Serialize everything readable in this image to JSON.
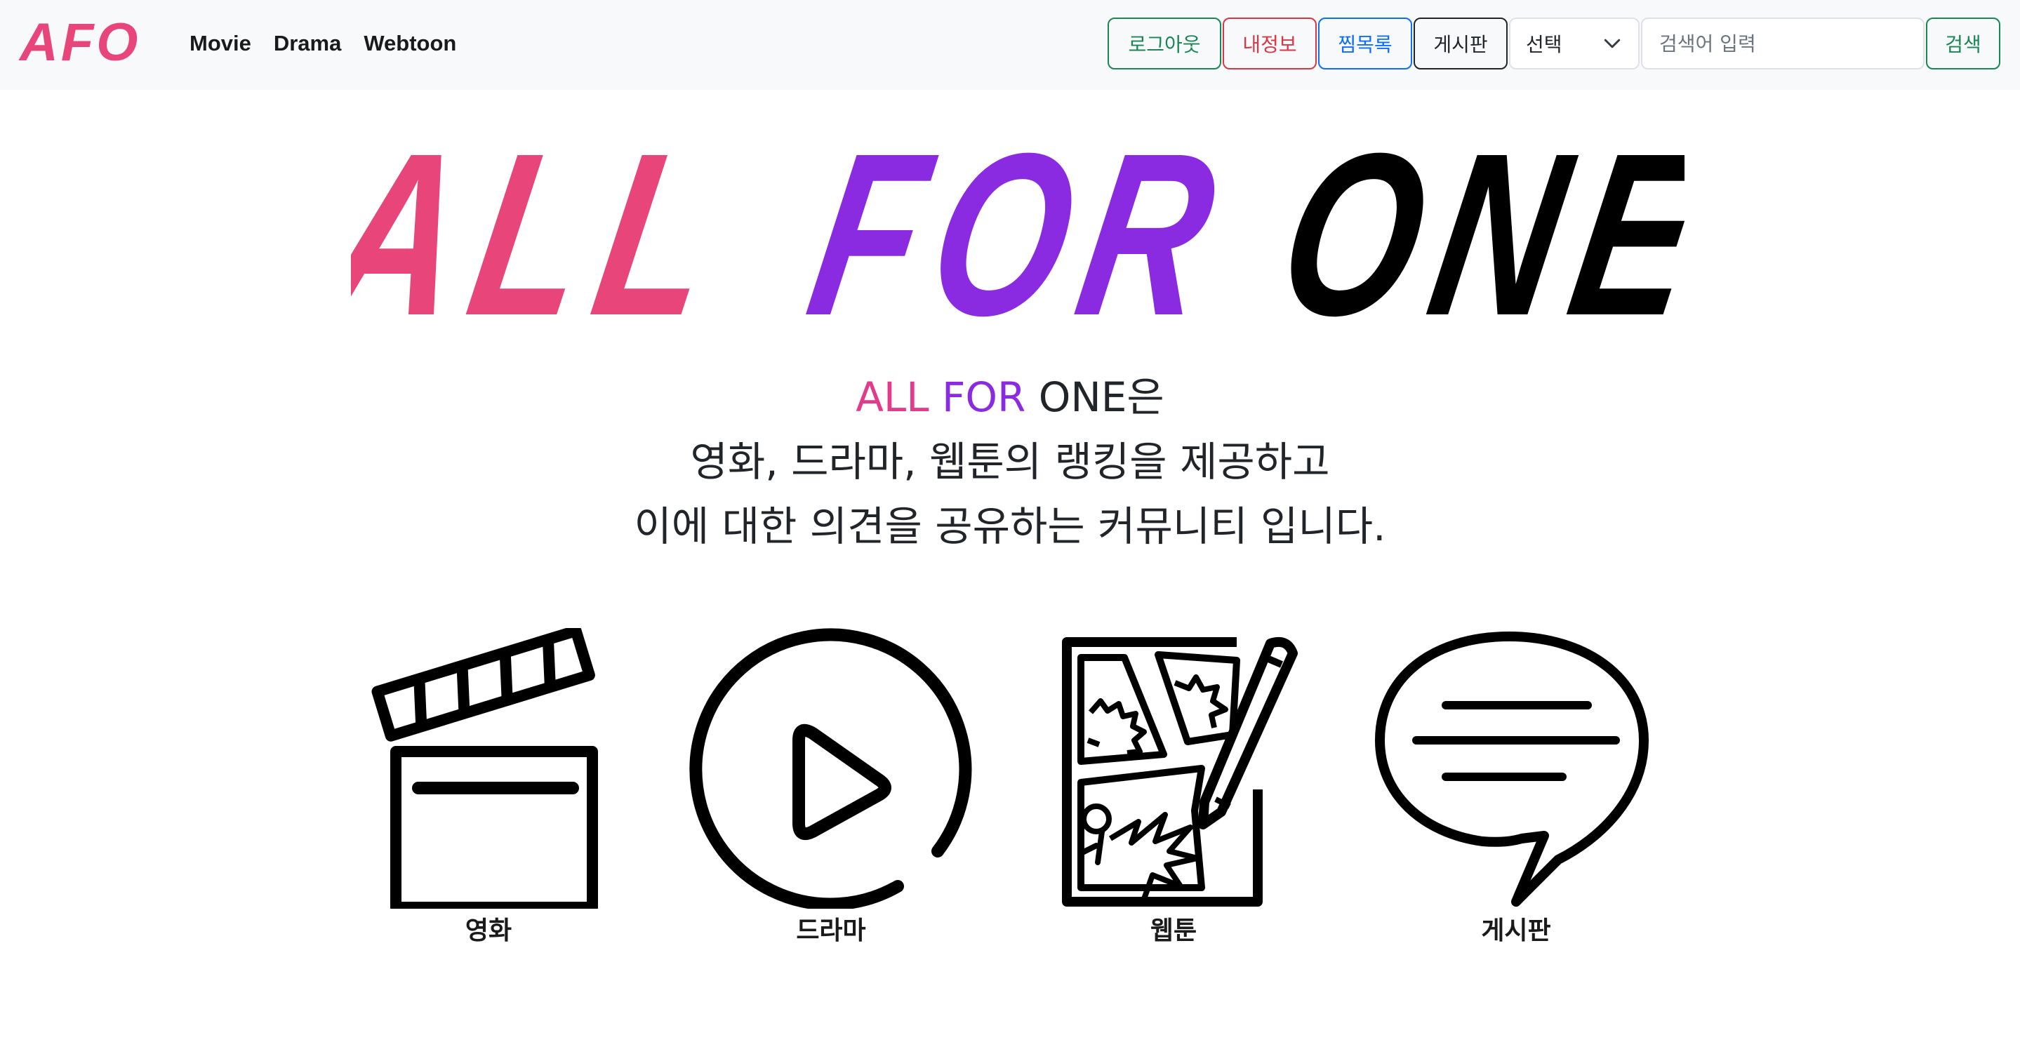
{
  "navbar": {
    "brand": "AFO",
    "links": [
      "Movie",
      "Drama",
      "Webtoon"
    ],
    "buttons": {
      "logout": "로그아웃",
      "my_info": "내정보",
      "wishlist": "찜목록",
      "board": "게시판"
    },
    "select": {
      "value": "선택"
    },
    "search": {
      "placeholder": "검색어 입력",
      "button": "검색"
    }
  },
  "hero": {
    "logo_words": [
      "ALL",
      "FOR",
      "ONE"
    ]
  },
  "intro": {
    "line1_parts": [
      "ALL",
      "FOR",
      "ONE은"
    ],
    "line2": "영화, 드라마, 웹툰의 랭킹을 제공하고",
    "line3": "이에 대한 의견을 공유하는 커뮤니티 입니다."
  },
  "categories": [
    {
      "label": "영화",
      "icon": "clapperboard-icon"
    },
    {
      "label": "드라마",
      "icon": "play-circle-icon"
    },
    {
      "label": "웹툰",
      "icon": "comic-pencil-icon"
    },
    {
      "label": "게시판",
      "icon": "speech-bubble-icon"
    }
  ],
  "colors": {
    "brand_pink": "#e8467a",
    "intro_pink": "#e23b8c",
    "purple": "#8a2be2",
    "navbar_bg": "#f8f9fa"
  }
}
